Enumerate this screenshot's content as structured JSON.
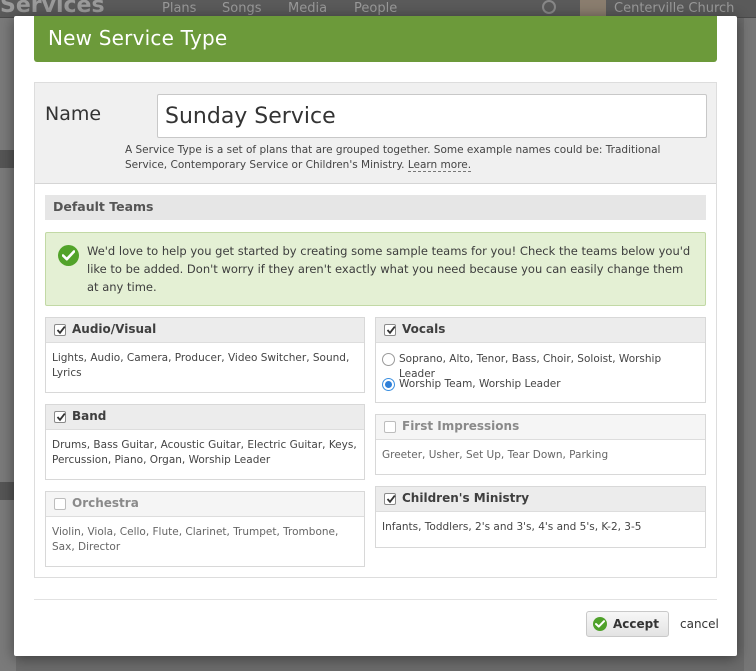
{
  "background": {
    "app_title": "Services",
    "nav": [
      "Plans",
      "Songs",
      "Media",
      "People"
    ],
    "org_name": "Centerville Church"
  },
  "modal": {
    "title": "New Service Type",
    "name_label": "Name",
    "name_value": "Sunday Service",
    "help_text": "A Service Type is a set of plans that are grouped together. Some example names could be: Traditional Service, Contemporary Service or Children's Ministry. ",
    "learn_more": "Learn more.",
    "default_teams_header": "Default Teams",
    "notice": "We'd love to help you get started by creating some sample teams for you! Check the teams below you'd like to be added. Don't worry if they aren't exactly what you need because you can easily change them at any time.",
    "teams_left": [
      {
        "name": "Audio/Visual",
        "checked": true,
        "positions": "Lights, Audio, Camera, Producer, Video Switcher, Sound, Lyrics"
      },
      {
        "name": "Band",
        "checked": true,
        "positions": "Drums, Bass Guitar, Acoustic Guitar, Electric Guitar, Keys, Percussion, Piano, Organ, Worship Leader"
      },
      {
        "name": "Orchestra",
        "checked": false,
        "positions": "Violin, Viola, Cello, Flute, Clarinet, Trumpet, Trombone, Sax, Director"
      }
    ],
    "vocals": {
      "name": "Vocals",
      "checked": true,
      "options": [
        {
          "label": "Soprano, Alto, Tenor, Bass, Choir, Soloist, Worship Leader",
          "selected": false
        },
        {
          "label": "Worship Team, Worship Leader",
          "selected": true
        }
      ]
    },
    "teams_right": [
      {
        "name": "First Impressions",
        "checked": false,
        "positions": "Greeter, Usher, Set Up, Tear Down, Parking"
      },
      {
        "name": "Children's Ministry",
        "checked": true,
        "positions": "Infants, Toddlers, 2's and 3's, 4's and 5's, K-2, 3-5"
      }
    ],
    "accept_label": "Accept",
    "cancel_label": "cancel"
  },
  "colors": {
    "header_green": "#6c9a3a",
    "notice_bg": "#e4f0d4",
    "check_green": "#52a32a",
    "radio_blue": "#2f80d8"
  }
}
